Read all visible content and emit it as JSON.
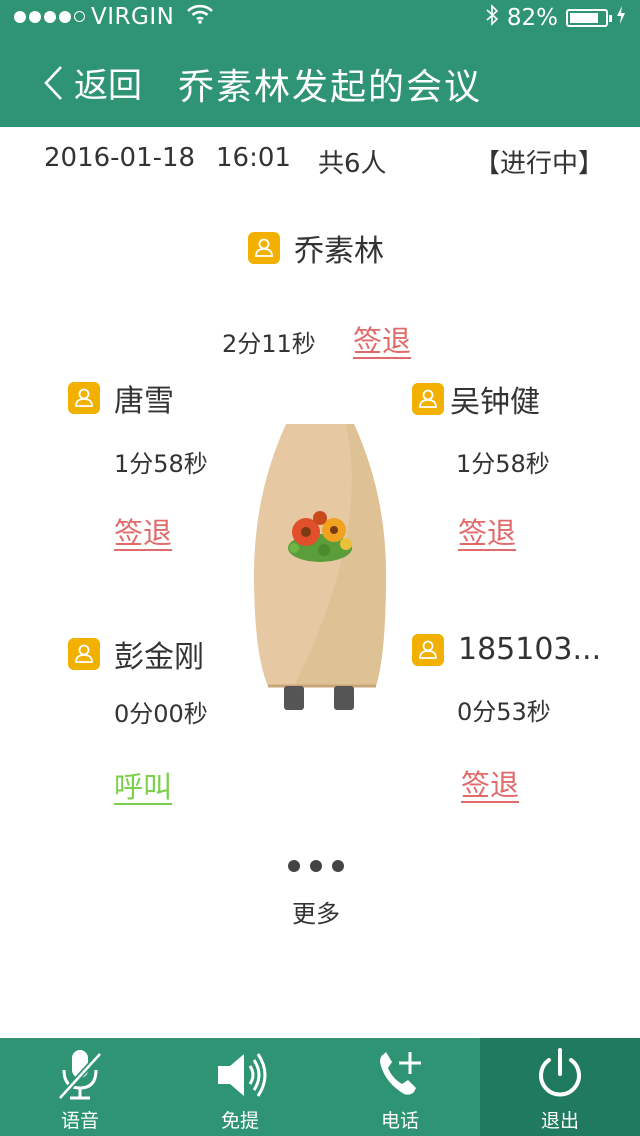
{
  "status": {
    "carrier": "VIRGIN",
    "battery_text": "82%",
    "battery_level": 0.82
  },
  "nav": {
    "back_label": "返回",
    "title": "乔素林发起的会议"
  },
  "meeting": {
    "date": "2016-01-18",
    "time": "16:01",
    "count": "共6人",
    "state": "【进行中】"
  },
  "host": {
    "name": "乔素林",
    "duration": "2分11秒",
    "action": "签退"
  },
  "participants": [
    {
      "name": "唐雪",
      "duration": "1分58秒",
      "action": "签退",
      "action_color": "#e16a6a"
    },
    {
      "name": "吴钟健",
      "duration": "1分58秒",
      "action": "签退",
      "action_color": "#e16a6a"
    },
    {
      "name": "彭金刚",
      "duration": "0分00秒",
      "action": "呼叫",
      "action_color": "#7ad04a"
    },
    {
      "name": "185103...",
      "duration": "0分53秒",
      "action": "签退",
      "action_color": "#e16a6a"
    }
  ],
  "more_label": "更多",
  "toolbar": {
    "voice": "语音",
    "speaker": "免提",
    "phone": "电话",
    "exit": "退出"
  },
  "colors": {
    "brand": "#2e9474",
    "active_tab": "#207a5e",
    "signout": "#e16a6a",
    "call": "#7ad04a",
    "person_icon": "#f2b000"
  }
}
